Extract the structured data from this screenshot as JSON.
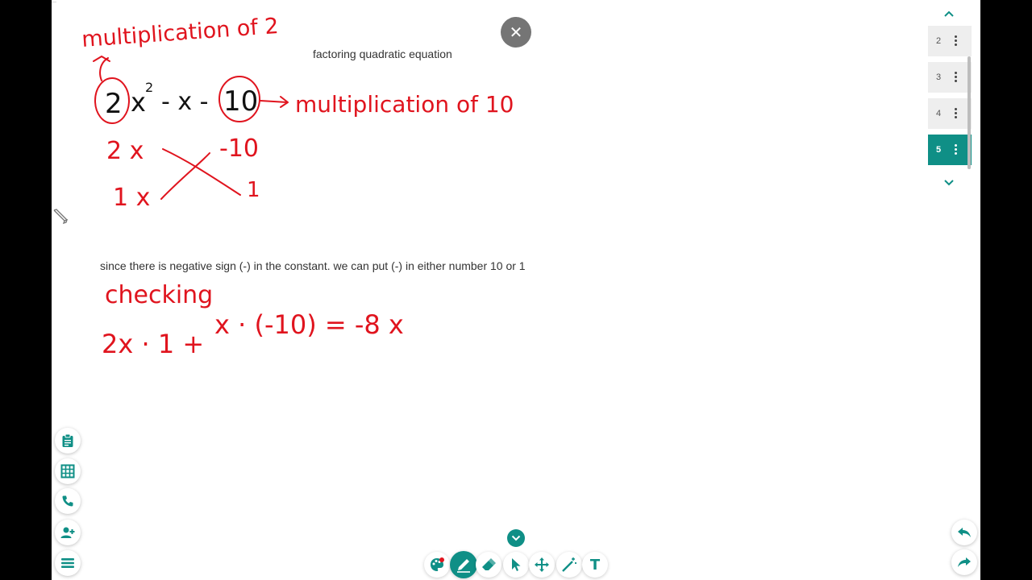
{
  "board": {
    "title_text": "factoring quadratic equation",
    "note_text": "since there is negative sign (-) in the constant. we can put (-) in either number 10 or 1"
  },
  "handwriting": {
    "label_top": "multiplication of 2",
    "expr_coef": "2",
    "expr_x": "x",
    "expr_exp": "2",
    "expr_minus_x": "- x -",
    "expr_const": "10",
    "label_right": "multiplication of 10",
    "row1_left": "2 x",
    "row1_right": "-10",
    "row2_left": "1 x",
    "row2_right": "1",
    "checking": "checking",
    "check_expr_a": "2x · 1 +",
    "check_expr_b": "x · (-10) = -8 x"
  },
  "pages": {
    "items": [
      {
        "num": "2",
        "active": false
      },
      {
        "num": "3",
        "active": false
      },
      {
        "num": "4",
        "active": false
      },
      {
        "num": "5",
        "active": true
      }
    ]
  },
  "colors": {
    "ink": "#e0141e",
    "accent": "#0f8f86",
    "close_bg": "#757575"
  },
  "icons": {
    "left_tools": [
      "clipboard-icon",
      "grid-icon",
      "phone-icon",
      "add-user-icon",
      "menu-icon"
    ],
    "right_tools": [
      "undo-icon",
      "redo-icon"
    ],
    "bottom_tools": [
      "palette-icon",
      "pen-icon",
      "eraser-icon",
      "pointer-icon",
      "move-icon",
      "magic-wand-icon",
      "text-icon"
    ]
  },
  "toolbar": {
    "text_tool_label": "T"
  }
}
